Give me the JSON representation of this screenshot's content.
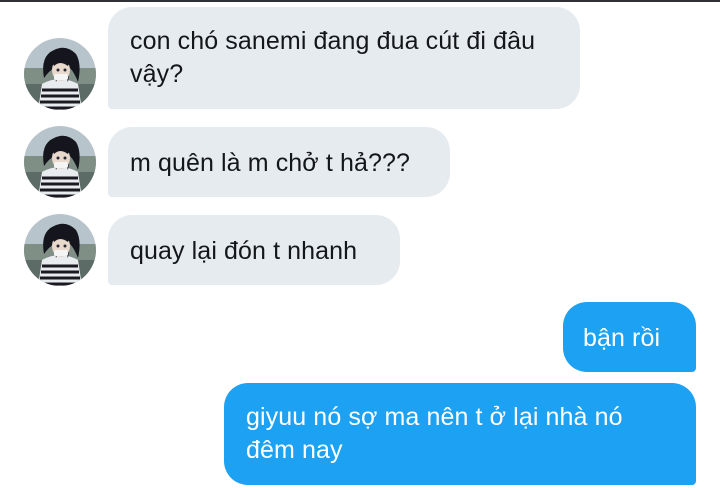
{
  "conversation": {
    "messages": [
      {
        "sender": "other",
        "text": "con chó sanemi đang đua cút đi đâu vậy?"
      },
      {
        "sender": "other",
        "text": "m quên là m chở t hả???"
      },
      {
        "sender": "other",
        "text": "quay lại đón t nhanh"
      },
      {
        "sender": "me",
        "text": "bận rồi"
      },
      {
        "sender": "me",
        "text": "giyuu nó sợ ma nên t ở lại nhà nó đêm nay"
      }
    ]
  },
  "colors": {
    "incoming_bubble": "#e6ebf0",
    "incoming_text": "#14171a",
    "outgoing_bubble": "#1da1f2",
    "outgoing_text": "#ffffff",
    "background": "#ffffff"
  },
  "icons": {
    "avatar": "profile-avatar-icon"
  }
}
